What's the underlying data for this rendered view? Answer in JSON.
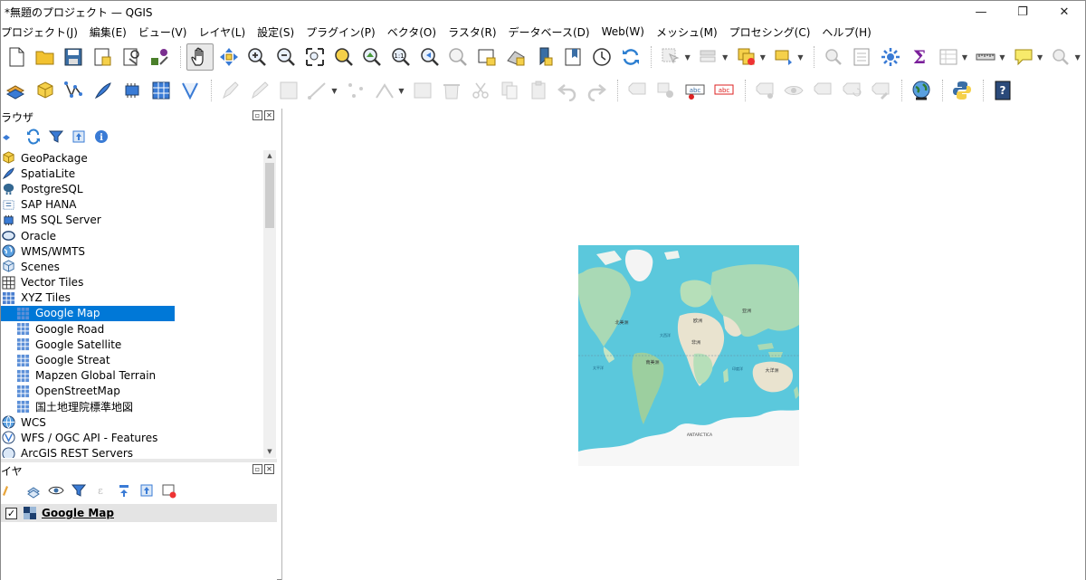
{
  "window": {
    "title": "*無題のプロジェクト — QGIS",
    "minimize": "—",
    "restore": "❐",
    "close": "✕"
  },
  "menu": [
    "プロジェクト(J)",
    "編集(E)",
    "ビュー(V)",
    "レイヤ(L)",
    "設定(S)",
    "プラグイン(P)",
    "ベクタ(O)",
    "ラスタ(R)",
    "データベース(D)",
    "Web(W)",
    "メッシュ(M)",
    "プロセシング(C)",
    "ヘルプ(H)"
  ],
  "browser": {
    "title": "ラウザ",
    "items": [
      {
        "label": "GeoPackage",
        "icon": "geopackage-icon",
        "child": false
      },
      {
        "label": "SpatiaLite",
        "icon": "spatialite-icon",
        "child": false
      },
      {
        "label": "PostgreSQL",
        "icon": "postgresql-icon",
        "child": false
      },
      {
        "label": "SAP HANA",
        "icon": "sap-hana-icon",
        "child": false
      },
      {
        "label": "MS SQL Server",
        "icon": "mssql-icon",
        "child": false
      },
      {
        "label": "Oracle",
        "icon": "oracle-icon",
        "child": false
      },
      {
        "label": "WMS/WMTS",
        "icon": "wms-icon",
        "child": false
      },
      {
        "label": "Scenes",
        "icon": "scenes-icon",
        "child": false
      },
      {
        "label": "Vector Tiles",
        "icon": "vector-tiles-icon",
        "child": false
      },
      {
        "label": "XYZ Tiles",
        "icon": "xyz-tiles-icon",
        "child": false
      },
      {
        "label": "Google Map",
        "icon": "xyz-tile-icon",
        "child": true,
        "selected": true
      },
      {
        "label": "Google Road",
        "icon": "xyz-tile-icon",
        "child": true
      },
      {
        "label": "Google Satellite",
        "icon": "xyz-tile-icon",
        "child": true
      },
      {
        "label": "Google Streat",
        "icon": "xyz-tile-icon",
        "child": true
      },
      {
        "label": "Mapzen Global Terrain",
        "icon": "xyz-tile-icon",
        "child": true
      },
      {
        "label": "OpenStreetMap",
        "icon": "xyz-tile-icon",
        "child": true
      },
      {
        "label": "国土地理院標準地図",
        "icon": "xyz-tile-icon",
        "child": true
      },
      {
        "label": "WCS",
        "icon": "wcs-icon",
        "child": false
      },
      {
        "label": "WFS / OGC API - Features",
        "icon": "wfs-icon",
        "child": false
      },
      {
        "label": "ArcGIS REST Servers",
        "icon": "arcgis-icon",
        "child": false
      }
    ]
  },
  "layers": {
    "title": "イヤ",
    "items": [
      {
        "label": "Google Map",
        "checked": true
      }
    ]
  },
  "map": {
    "labels": {
      "north_america": "北美洲",
      "europe": "欧洲",
      "asia": "亚洲",
      "africa": "非洲",
      "south_america": "南美洲",
      "oceania": "大洋洲",
      "atlantic": "大西洋",
      "pacific": "太平洋",
      "indian": "印度洋",
      "antarctica": "ANTARCTICA"
    }
  }
}
